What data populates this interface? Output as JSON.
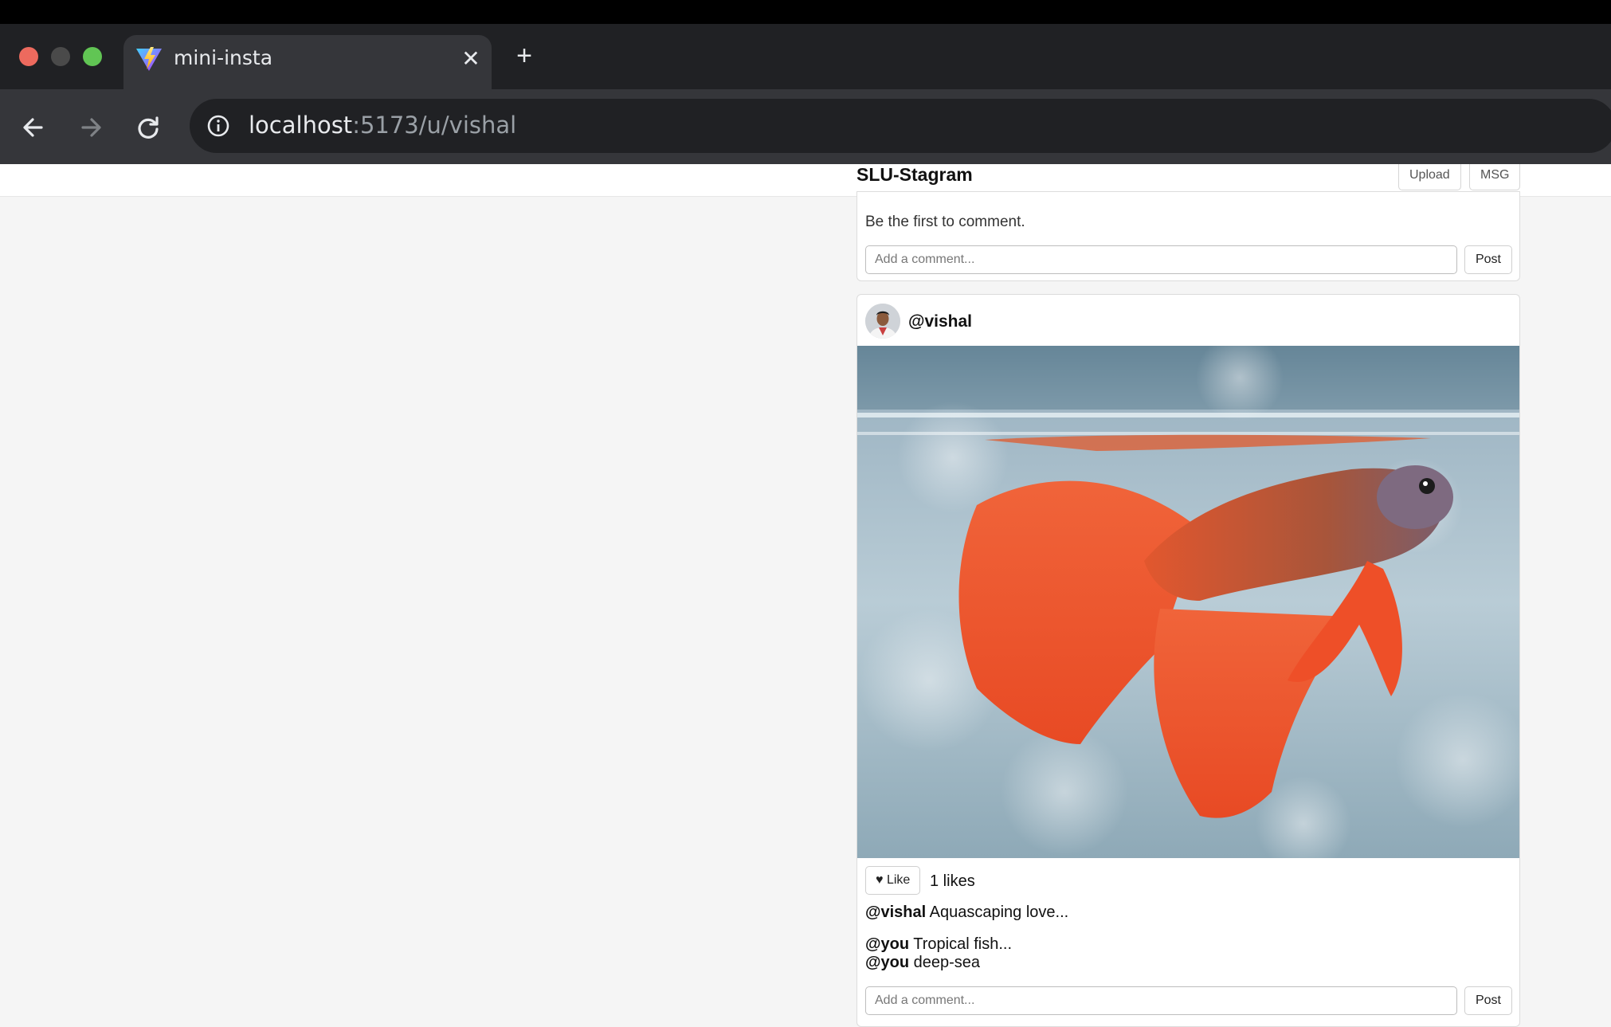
{
  "browser": {
    "tab_title": "mini-insta",
    "new_tab_symbol": "+",
    "close_symbol": "✕",
    "url_host": "localhost",
    "url_path": ":5173/u/vishal"
  },
  "header": {
    "brand": "SLU-Stagram",
    "upload_label": "Upload",
    "msg_label": "MSG"
  },
  "previous_post": {
    "empty_comments": "Be the first to comment.",
    "comment_placeholder": "Add a comment...",
    "post_label": "Post"
  },
  "post": {
    "username": "@vishal",
    "image_description": "orange-red betta fish",
    "like_label": "♥ Like",
    "likes_text": "1 likes",
    "caption_user": "@vishal",
    "caption_text": " Aquascaping love...",
    "comments": [
      {
        "user": "@you",
        "text": " Tropical fish..."
      },
      {
        "user": "@you",
        "text": " deep-sea"
      }
    ],
    "comment_placeholder": "Add a comment...",
    "post_label": "Post"
  }
}
